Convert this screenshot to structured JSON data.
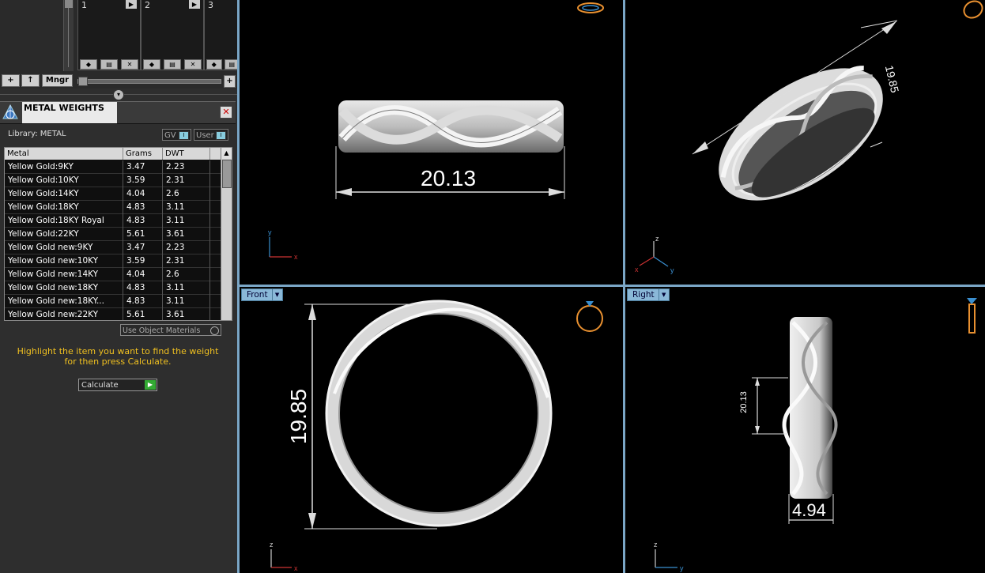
{
  "thumbs": {
    "slots": [
      {
        "num": "1"
      },
      {
        "num": "2"
      },
      {
        "num": "3"
      }
    ],
    "mngr_label": "Mngr"
  },
  "panel": {
    "title": "METAL WEIGHTS",
    "library_label": "Library: METAL",
    "gv_label": "GV",
    "user_label": "User",
    "columns": [
      "Metal",
      "Grams",
      "DWT"
    ],
    "rows": [
      {
        "metal": "Yellow Gold:9KY",
        "grams": "3.47",
        "dwt": "2.23"
      },
      {
        "metal": "Yellow Gold:10KY",
        "grams": "3.59",
        "dwt": "2.31"
      },
      {
        "metal": "Yellow Gold:14KY",
        "grams": "4.04",
        "dwt": "2.6"
      },
      {
        "metal": "Yellow Gold:18KY",
        "grams": "4.83",
        "dwt": "3.11"
      },
      {
        "metal": "Yellow Gold:18KY Royal",
        "grams": "4.83",
        "dwt": "3.11"
      },
      {
        "metal": "Yellow Gold:22KY",
        "grams": "5.61",
        "dwt": "3.61"
      },
      {
        "metal": "Yellow Gold new:9KY",
        "grams": "3.47",
        "dwt": "2.23"
      },
      {
        "metal": "Yellow Gold new:10KY",
        "grams": "3.59",
        "dwt": "2.31"
      },
      {
        "metal": "Yellow Gold new:14KY",
        "grams": "4.04",
        "dwt": "2.6"
      },
      {
        "metal": "Yellow Gold new:18KY",
        "grams": "4.83",
        "dwt": "3.11"
      },
      {
        "metal": "Yellow Gold new:18KY...",
        "grams": "4.83",
        "dwt": "3.11"
      },
      {
        "metal": "Yellow Gold new:22KY",
        "grams": "5.61",
        "dwt": "3.61"
      }
    ],
    "use_object_materials": "Use Object Materials",
    "hint": "Highlight the item you want to find the weight for then press Calculate.",
    "calculate_label": "Calculate"
  },
  "viewports": {
    "top_left": {
      "dimension": "20.13",
      "axes": [
        "y",
        "x"
      ]
    },
    "top_right": {
      "dimension": "19.85",
      "axes": [
        "z",
        "x",
        "y"
      ]
    },
    "bottom_left": {
      "label": "Front",
      "dimension": "19.85",
      "axes": [
        "z",
        "x"
      ]
    },
    "bottom_right": {
      "label": "Right",
      "dimension_width": "4.94",
      "dimension_small": "20.13",
      "axes": [
        "z",
        "y"
      ]
    }
  },
  "colors": {
    "hint_text": "#f0c020",
    "viewport_label_bg": "#8ab8d8",
    "viewport_border": "#7aa6c6",
    "axis_red": "#c33",
    "axis_blue": "#3a8fd0",
    "ring_icon_orange": "#e89030"
  }
}
